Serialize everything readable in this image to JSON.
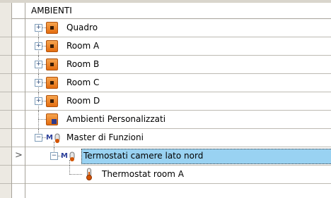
{
  "grid": {
    "column_header": "AMBIENTI",
    "rows": [
      {
        "label": "Quadro",
        "icon": "room-icon",
        "expander": "+"
      },
      {
        "label": "Room A",
        "icon": "room-icon",
        "expander": "+"
      },
      {
        "label": "Room B",
        "icon": "room-icon",
        "expander": "+"
      },
      {
        "label": "Room C",
        "icon": "room-icon",
        "expander": "+"
      },
      {
        "label": "Room D",
        "icon": "room-icon",
        "expander": "+"
      },
      {
        "label": "Ambienti Personalizzati",
        "icon": "custom-room-icon",
        "expander": ""
      },
      {
        "label": "Master di Funzioni",
        "icon": "master-functions-icon",
        "expander": "−"
      },
      {
        "label": "Termostati camere lato nord",
        "icon": "master-functions-icon",
        "expander": "−",
        "selected": true,
        "current_row_marker": ">"
      },
      {
        "label": "Thermostat room A",
        "icon": "thermostat-icon",
        "expander": ""
      }
    ]
  },
  "colors": {
    "selection": "#99d2f2",
    "room_icon": "#f08a2c",
    "header_bg": "#ffffff"
  }
}
